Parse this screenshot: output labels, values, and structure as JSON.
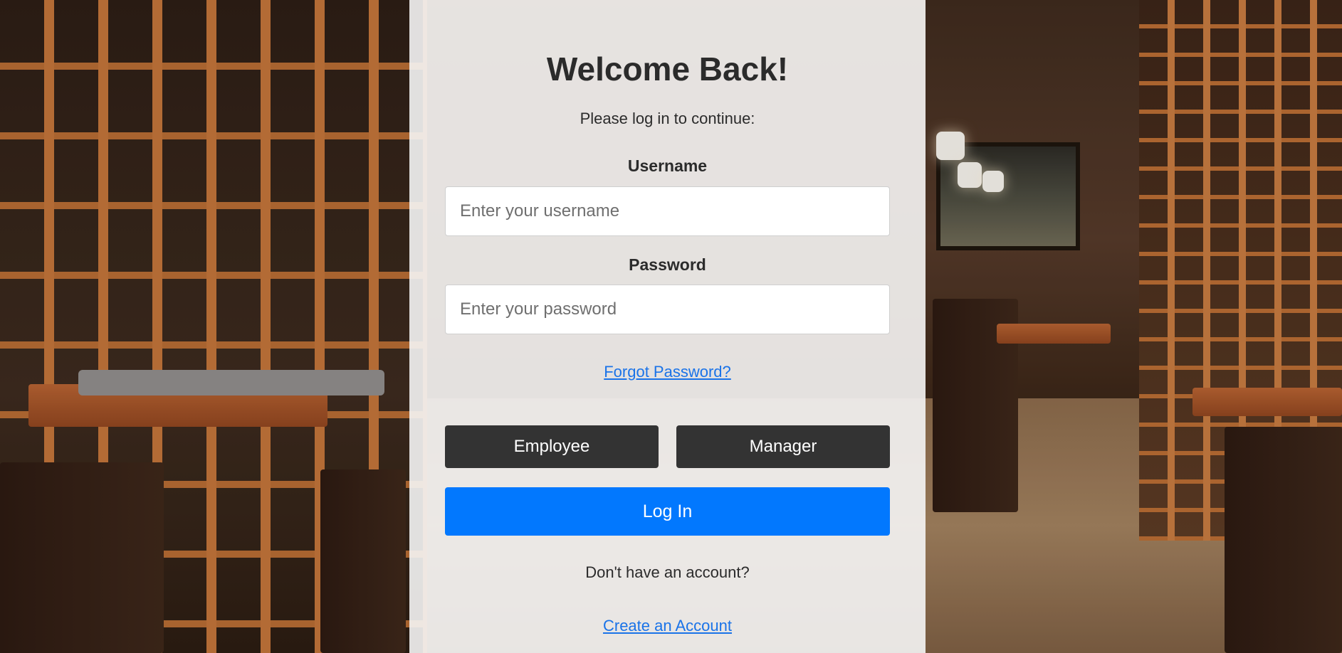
{
  "login": {
    "title": "Welcome Back!",
    "subtitle": "Please log in to continue:",
    "username_label": "Username",
    "username_placeholder": "Enter your username",
    "password_label": "Password",
    "password_placeholder": "Enter your password",
    "forgot_password": "Forgot Password?",
    "role_employee": "Employee",
    "role_manager": "Manager",
    "login_button": "Log In",
    "no_account_text": "Don't have an account?",
    "create_account": "Create an Account"
  },
  "colors": {
    "primary_button": "#0278fe",
    "role_button": "#333333",
    "link": "#1a73e8",
    "panel_bg": "#f5f5f5"
  }
}
